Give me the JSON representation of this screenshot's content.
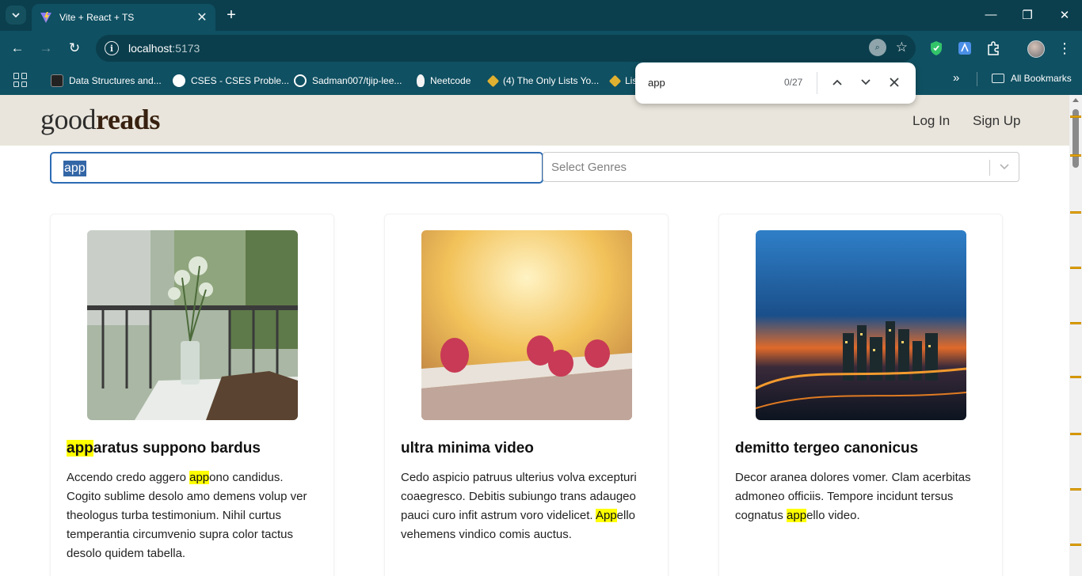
{
  "browser": {
    "tab_title": "Vite + React + TS",
    "url_host": "localhost",
    "url_port": ":5173",
    "bookmarks": [
      "Data Structures and...",
      "CSES - CSES Proble...",
      "Sadman007/tjip-lee...",
      "Neetcode",
      "(4) The Only Lists Yo...",
      "Lis"
    ],
    "all_bookmarks": "All Bookmarks",
    "find": {
      "query": "app",
      "count": "0/27"
    }
  },
  "site": {
    "logo_light": "good",
    "logo_bold": "reads",
    "login": "Log In",
    "signup": "Sign Up",
    "search_value": "app",
    "genre_placeholder": "Select Genres"
  },
  "books": [
    {
      "title_mark": "app",
      "title_rest": "aratus suppono bardus",
      "desc_before": "Accendo credo aggero ",
      "desc_mark": "app",
      "desc_after": "ono candidus. Cogito sublime desolo amo demens volup ver theologus turba testimonium. Nihil curtus temperantia circumvenio supra color tactus desolo quidem tabella."
    },
    {
      "title": "ultra minima video",
      "desc_before": "Cedo aspicio patruus ulterius volva excepturi coaegresco. Debitis subiungo trans adaugeo pauci curo infit astrum voro videlicet. ",
      "desc_mark": "App",
      "desc_after": "ello vehemens vindico comis auctus."
    },
    {
      "title": "demitto tergeo canonicus",
      "desc_before": "Decor aranea dolores vomer. Clam acerbitas admoneo officiis. Tempore incidunt tersus cognatus ",
      "desc_mark": "app",
      "desc_after": "ello video."
    }
  ],
  "colors": {
    "chrome": "#0f5062",
    "header_bg": "#e9e5dc",
    "highlight": "#ffff00"
  }
}
